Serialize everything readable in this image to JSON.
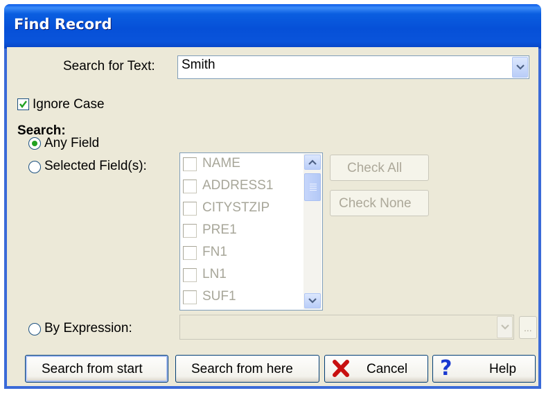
{
  "window": {
    "title": "Find Record"
  },
  "search_text": {
    "label": "Search for Text:",
    "value": "Smith"
  },
  "ignore_case": {
    "label": "Ignore Case",
    "checked": true
  },
  "search_group": {
    "heading": "Search:",
    "any_field": "Any Field",
    "selected_fields": "Selected Field(s):",
    "by_expression": "By Expression:",
    "selected_option": "Any Field"
  },
  "fields": [
    "NAME",
    "ADDRESS1",
    "CITYSTZIP",
    "PRE1",
    "FN1",
    "LN1",
    "SUF1"
  ],
  "buttons": {
    "check_all": "Check All",
    "check_none": "Check None",
    "ellipsis": "...",
    "search_from_start": "Search from start",
    "search_from_here": "Search from here",
    "cancel": "Cancel",
    "help": "Help"
  },
  "icons": {
    "dropdown": "chevron-down-icon",
    "cancel": "red-x-icon",
    "help": "question-mark-icon",
    "scroll_up": "chevron-up-icon",
    "scroll_down": "chevron-down-icon"
  },
  "colors": {
    "titlebar": "#0a54da",
    "client_bg": "#ece9d8",
    "radio_dot": "#21a121",
    "check_mark": "#21a121",
    "disabled_text": "#a7a699",
    "cancel_icon": "#c81010",
    "help_icon": "#1a3ad0"
  }
}
